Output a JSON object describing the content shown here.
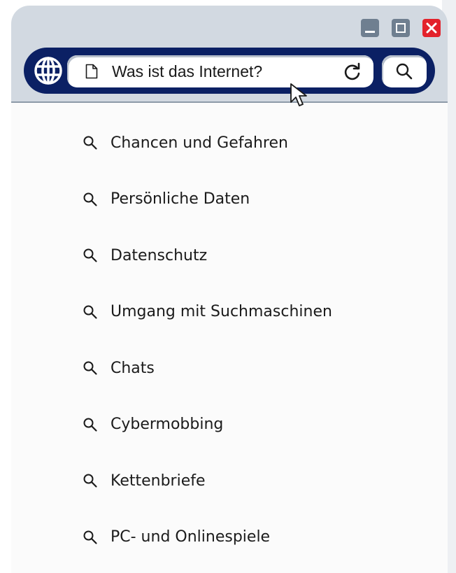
{
  "window": {
    "controls": {
      "minimize_icon": "minimize-icon",
      "maximize_icon": "maximize-icon",
      "close_icon": "close-icon",
      "close_color": "#e3222b",
      "control_color": "#6f7f90"
    }
  },
  "navbar": {
    "background": "#0b2064",
    "globe_icon": "globe-icon",
    "address": {
      "page_icon": "document-icon",
      "value": "Was ist das Internet?",
      "reload_icon": "reload-icon"
    },
    "search_icon": "search-icon"
  },
  "suggestions": [
    {
      "label": "Chancen und Gefahren",
      "icon": "search-icon"
    },
    {
      "label": "Persönliche Daten",
      "icon": "search-icon"
    },
    {
      "label": "Datenschutz",
      "icon": "search-icon"
    },
    {
      "label": "Umgang mit Suchmaschinen",
      "icon": "search-icon"
    },
    {
      "label": "Chats",
      "icon": "search-icon"
    },
    {
      "label": "Cybermobbing",
      "icon": "search-icon"
    },
    {
      "label": "Kettenbriefe",
      "icon": "search-icon"
    },
    {
      "label": "PC- und Onlinespiele",
      "icon": "search-icon"
    }
  ]
}
